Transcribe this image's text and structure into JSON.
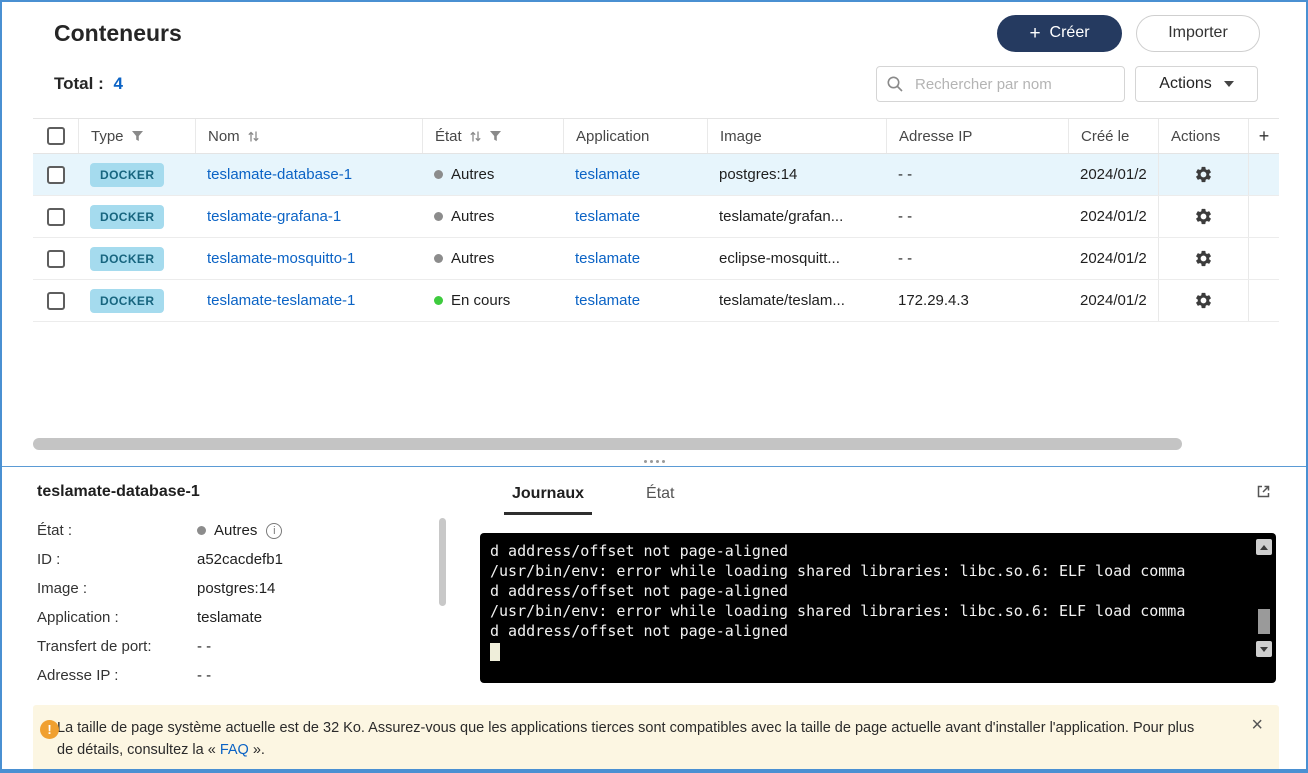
{
  "header": {
    "title": "Conteneurs",
    "create_label": "Créer",
    "import_label": "Importer"
  },
  "toolbar": {
    "total_label": "Total :",
    "total_count": "4",
    "search_placeholder": "Rechercher par nom",
    "actions_label": "Actions"
  },
  "table": {
    "columns": {
      "type": "Type",
      "name": "Nom",
      "state": "État",
      "application": "Application",
      "image": "Image",
      "ip": "Adresse IP",
      "created": "Créé le",
      "actions": "Actions",
      "add_column": "+"
    },
    "rows": [
      {
        "type_badge": "DOCKER",
        "name": "teslamate-database-1",
        "state": "Autres",
        "application": "teslamate",
        "image": "postgres:14",
        "ip": "- -",
        "created": "2024/01/2"
      },
      {
        "type_badge": "DOCKER",
        "name": "teslamate-grafana-1",
        "state": "Autres",
        "application": "teslamate",
        "image": "teslamate/grafan...",
        "ip": "- -",
        "created": "2024/01/2"
      },
      {
        "type_badge": "DOCKER",
        "name": "teslamate-mosquitto-1",
        "state": "Autres",
        "application": "teslamate",
        "image": "eclipse-mosquitt...",
        "ip": "- -",
        "created": "2024/01/2"
      },
      {
        "type_badge": "DOCKER",
        "name": "teslamate-teslamate-1",
        "state": "En cours",
        "application": "teslamate",
        "image": "teslamate/teslam...",
        "ip": "172.29.4.3",
        "created": "2024/01/2"
      }
    ]
  },
  "detail": {
    "title": "teslamate-database-1",
    "fields": [
      {
        "label": "État :",
        "value": "Autres"
      },
      {
        "label": "ID :",
        "value": "a52cacdefb1"
      },
      {
        "label": "Image :",
        "value": "postgres:14"
      },
      {
        "label": "Application :",
        "value": "teslamate"
      },
      {
        "label": "Transfert de port:",
        "value": "- -"
      },
      {
        "label": "Adresse IP :",
        "value": "- -"
      }
    ],
    "tabs": {
      "logs": "Journaux",
      "state": "État"
    },
    "terminal_lines": [
      "d address/offset not page-aligned",
      "/usr/bin/env: error while loading shared libraries: libc.so.6: ELF load comma",
      "d address/offset not page-aligned",
      "/usr/bin/env: error while loading shared libraries: libc.so.6: ELF load comma",
      "d address/offset not page-aligned"
    ]
  },
  "banner": {
    "message_before_link": "La taille de page système actuelle est de 32 Ko. Assurez-vous que les applications tierces sont compatibles avec la taille de page actuelle avant d'installer l'application. Pour plus de détails, consultez la « ",
    "link_label": "FAQ",
    "message_after_link": " »."
  },
  "icons": {
    "plus": "+",
    "close": "×",
    "info": "i",
    "warning": "!"
  },
  "colors": {
    "accent_blue": "#0b63c5",
    "create_button_bg": "#253a60",
    "badge_bg": "#a5dbee",
    "badge_text": "#17657f",
    "status_running": "#3ecb3e",
    "status_other": "#8c8c8c",
    "selected_row_bg": "#e7f5fc",
    "banner_bg": "#fcf6e2",
    "warning_icon": "#f0a030",
    "window_border": "#4a90d2"
  }
}
